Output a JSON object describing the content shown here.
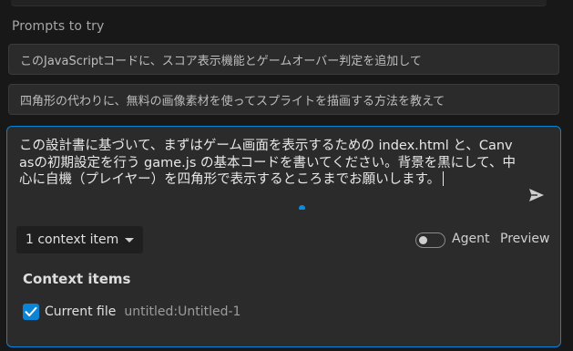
{
  "prompts": {
    "heading": "Prompts to try",
    "suggestions": [
      "このJavaScriptコードに、スコア表示機能とゲームオーバー判定を追加して",
      "四角形の代わりに、無料の画像素材を使ってスプライトを描画する方法を教えて"
    ]
  },
  "chat": {
    "input_text": "この設計書に基づいて、まずはゲーム画面を表示するための index.html と、Canvasの初期設定を行う game.js の基本コードを書いてください。背景を黒にして、中心に自機（プレイヤー）を四角形で表示するところまでお願いします。",
    "context_dropdown_label": "1 context item",
    "agent_label": "Agent",
    "agent_enabled": false,
    "preview_label": "Preview",
    "context_heading": "Context items",
    "context_items": [
      {
        "label": "Current file",
        "path": "untitled:Untitled-1",
        "checked": true
      }
    ]
  },
  "colors": {
    "accent": "#0a84d6",
    "background": "#181818",
    "panel": "#2b2b2b"
  },
  "icons": {
    "send": "send-icon",
    "dropdown": "chevron-down-icon",
    "check": "check-icon"
  }
}
